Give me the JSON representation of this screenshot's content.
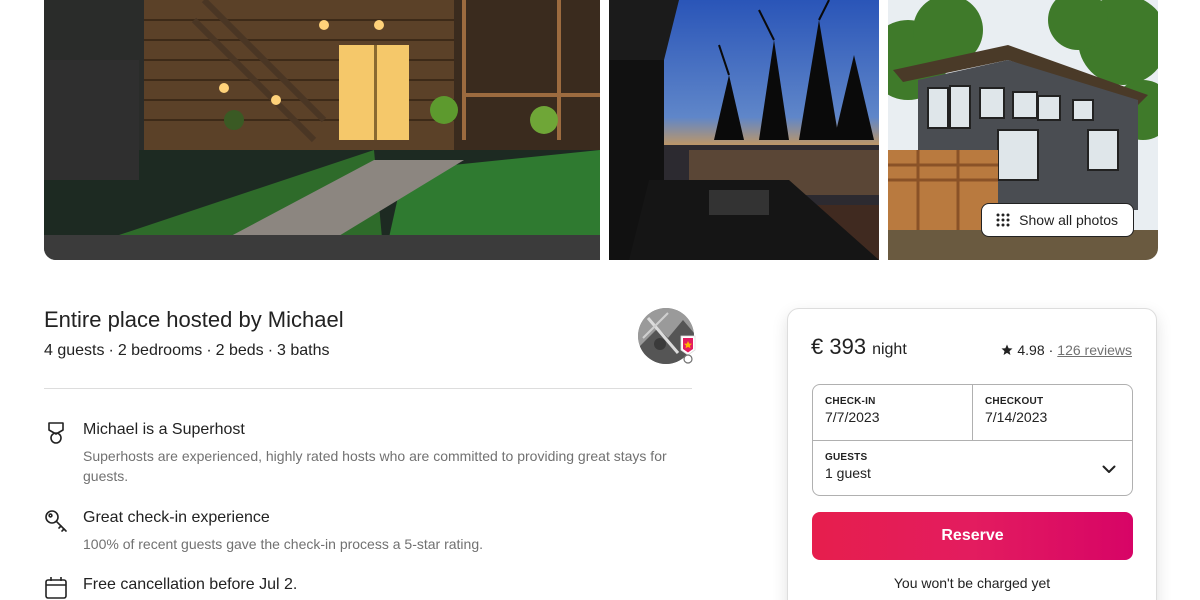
{
  "gallery": {
    "show_all_label": "Show all photos",
    "icons": {
      "grid": "dots-grid-icon"
    }
  },
  "host": {
    "title": "Entire place hosted by Michael",
    "details": [
      "4 guests",
      "2 bedrooms",
      "2 beds",
      "3 baths"
    ],
    "avatar_icon": "host-avatar",
    "badge_icon": "superhost-badge-icon"
  },
  "highlights": [
    {
      "icon": "superhost-medal-icon",
      "title": "Michael is a Superhost",
      "description": "Superhosts are experienced, highly rated hosts who are committed to providing great stays for guests."
    },
    {
      "icon": "key-icon",
      "title": "Great check-in experience",
      "description": "100% of recent guests gave the check-in process a 5-star rating."
    },
    {
      "icon": "calendar-icon",
      "title": "Free cancellation before Jul 2.",
      "description": ""
    }
  ],
  "booking": {
    "price": "€ 393",
    "price_unit": "night",
    "rating": "4.98",
    "reviews": "126 reviews",
    "checkin_label": "CHECK-IN",
    "checkin_value": "7/7/2023",
    "checkout_label": "CHECKOUT",
    "checkout_value": "7/14/2023",
    "guests_label": "GUESTS",
    "guests_value": "1 guest",
    "reserve_label": "Reserve",
    "no_charge_note": "You won't be charged yet",
    "colors": {
      "reserve": "#e31c5f",
      "text": "#222222",
      "muted": "#717171"
    }
  }
}
